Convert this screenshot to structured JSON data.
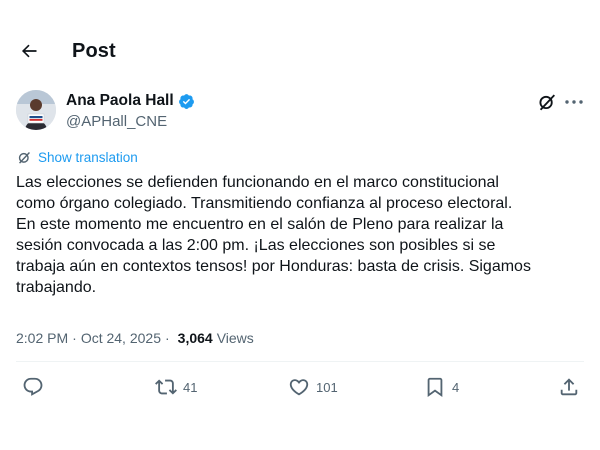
{
  "header": {
    "title": "Post",
    "back_icon": "arrow-left-icon"
  },
  "author": {
    "name": "Ana Paola Hall",
    "handle": "@APHall_CNE",
    "verified": true,
    "verified_color": "#1d9bf0"
  },
  "translate": {
    "label": "Show translation",
    "icon": "translate-icon"
  },
  "post": {
    "text": "Las elecciones se defienden funcionando en el marco constitucional\ncomo órgano colegiado. Transmitiendo confianza al proceso electoral.\nEn este momento me encuentro en el salón de Pleno para realizar la\nsesión convocada a las 2:00 pm.  ¡Las elecciones son posibles si se\ntrabaja aún en contextos tensos! por Honduras: basta  de crisis. Sigamos\ntrabajando."
  },
  "meta": {
    "time": "2:02 PM",
    "separator": "·",
    "date": "Oct 24, 2025",
    "separator2": "·",
    "views_count": "3,064",
    "views_label": "Views"
  },
  "actions": {
    "reply_count": "",
    "repost_count": "41",
    "like_count": "101",
    "bookmark_count": "4"
  },
  "colors": {
    "accent": "#1d9bf0",
    "secondary_text": "#536471",
    "primary_text": "#0f1419"
  }
}
